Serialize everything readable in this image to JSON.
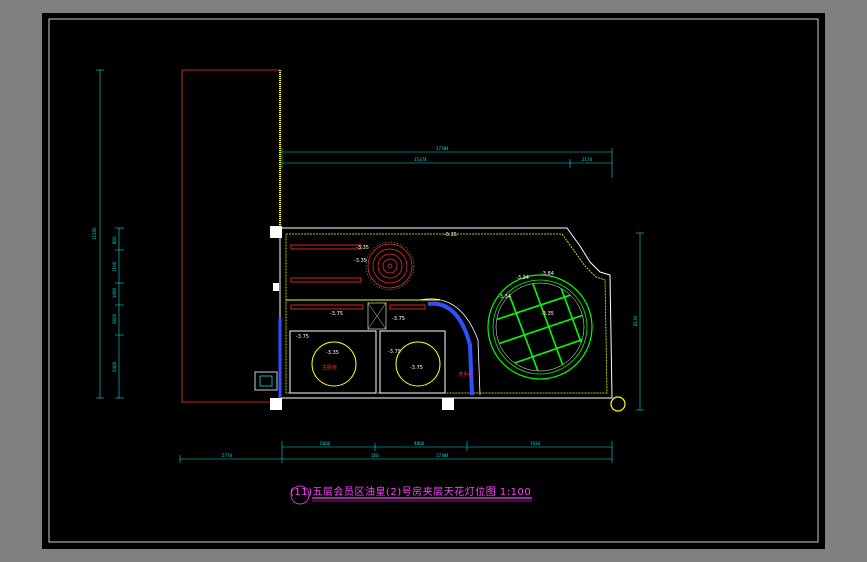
{
  "title": "(11)五层会员区油皇(2)号房夹层天花灯位图 1:100",
  "dimensions": {
    "top_total": "17384",
    "top_left": "15374",
    "top_right": "2174",
    "left_total": "11550",
    "left_a": "800",
    "left_b": "1100",
    "left_c": "1080",
    "left_d": "3600",
    "left_e": "2400",
    "right_height": "6130",
    "bottom_a": "5800",
    "bottom_b": "150",
    "bottom_c": "4800",
    "bottom_d": "7434",
    "bottom_total": "17384",
    "bottom_left": "5774"
  },
  "levels": {
    "l1": "-3.35",
    "l2": "-3.35",
    "l3": "-3.35",
    "l4": "-3.75",
    "l5": "-3.75",
    "l6": "-3.75",
    "l7": "-3.35",
    "l8": "-3.75",
    "l9": "-3.75",
    "l10": "-3.34",
    "l11": "-3.34",
    "l12": "-3.84",
    "l13": "-3.35"
  },
  "rooms": {
    "bedroom": "主卧房",
    "bath": "洗手间"
  },
  "colors": {
    "sheet": "#000000",
    "outline": "#ffffff",
    "dimension": "#00e0e0",
    "wall": "#ffff00",
    "lighting": "#00ff00",
    "title": "#ff40ff"
  }
}
